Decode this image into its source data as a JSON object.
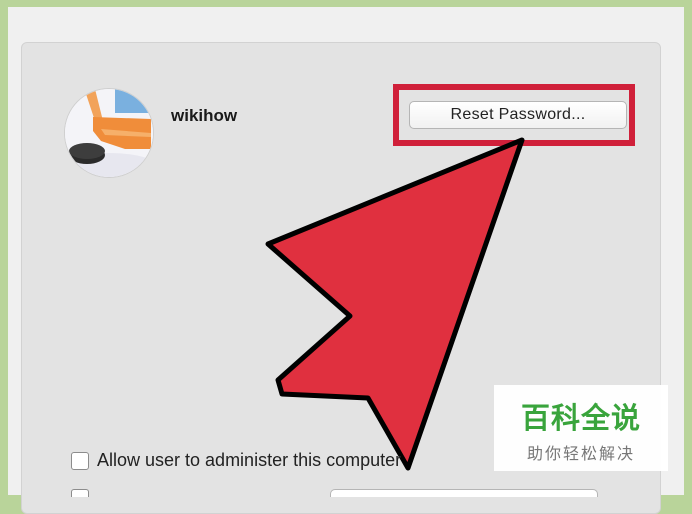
{
  "user": {
    "name": "wikihow",
    "avatar": "hockey-stick-and-puck-image"
  },
  "reset_button": {
    "label": "Reset Password..."
  },
  "admin_checkbox": {
    "label": "Allow user to administer this computer",
    "checked": false
  },
  "watermark": {
    "title": "百科全说",
    "subtitle": "助你轻松解决"
  },
  "colors": {
    "highlight": "#d0203a",
    "arrow_fill": "#e0303f",
    "border_bg": "#b9d49a",
    "watermark_green": "#39a43c"
  }
}
